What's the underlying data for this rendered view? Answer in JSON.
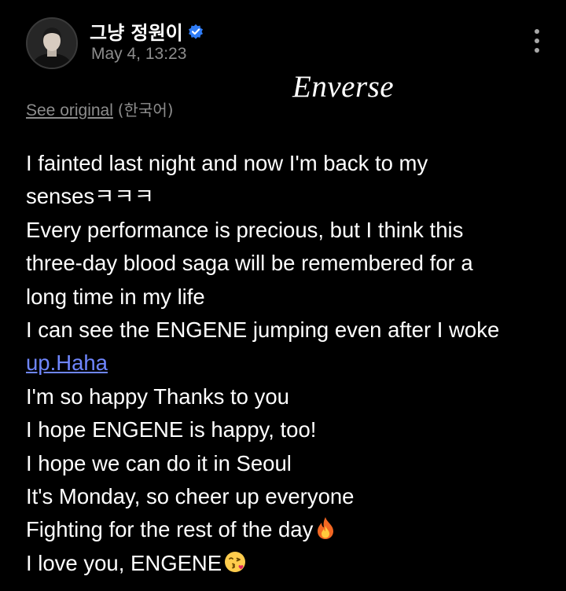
{
  "post": {
    "author": "그냥 정원이",
    "timestamp": "May 4, 13:23",
    "watermark": "Enverse",
    "see_original_label": "See original",
    "original_language": "(한국어)",
    "lines": {
      "l1": "I fainted last night and now I'm back to my",
      "l2": "sensesㅋㅋㅋ",
      "l3": "Every performance is precious, but I think this",
      "l4": "three-day blood saga will be remembered for a",
      "l5": "long time in my life",
      "l6": "I can see the ENGENE jumping even after I woke",
      "l7_link": "up.Haha",
      "l8": "I'm so happy Thanks to you",
      "l9": "I hope ENGENE is happy, too!",
      "l10": "I hope we can do it in Seoul",
      "l11": "It's Monday, so cheer up everyone",
      "l12": "Fighting for the rest of the day",
      "l13": "I love you, ENGENE"
    }
  },
  "icons": {
    "verified": "verified-badge-icon",
    "more": "more-vertical-icon",
    "fire": "fire-emoji-icon",
    "kiss": "kissing-face-emoji-icon"
  },
  "colors": {
    "background": "#000000",
    "text": "#ffffff",
    "muted": "#8d8d8d",
    "link": "#6f86ff",
    "verified": "#2f7cf6"
  }
}
